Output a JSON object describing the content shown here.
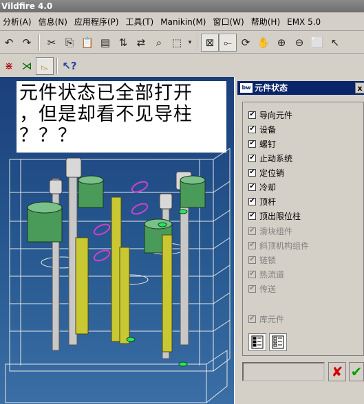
{
  "window": {
    "title": "Vildfire 4.0"
  },
  "menu": [
    "分析(A)",
    "信息(N)",
    "应用程序(P)",
    "工具(T)",
    "Manikin(M)",
    "窗口(W)",
    "帮助(H)",
    "EMX 5.0"
  ],
  "toolbar1_icons": [
    "undo-icon",
    "redo-icon",
    "cut-icon",
    "copy-icon",
    "paste-icon",
    "paste-special-icon",
    "regen-icon",
    "regen-manager-icon",
    "find-icon",
    "select-box-icon",
    "dropdown-icon",
    "repaint-icon",
    "spin-center-icon",
    "orient-mode-icon",
    "pan-icon",
    "zoom-in-icon",
    "zoom-out-icon",
    "refit-icon",
    "cursor-icon"
  ],
  "toolbar2_icons": [
    "datum-axes-icon",
    "datum-points-icon",
    "coord-sys-icon",
    "whats-this-icon"
  ],
  "annotation": {
    "line1": "元件状态已全部打开",
    "line2": "，但是却看不见导柱",
    "line3": "？？？"
  },
  "panel": {
    "title": "元件状态",
    "logo": "bw",
    "close": "x",
    "items": [
      {
        "label": "导向元件",
        "checked": true,
        "enabled": true
      },
      {
        "label": "设备",
        "checked": true,
        "enabled": true
      },
      {
        "label": "螺钉",
        "checked": true,
        "enabled": true
      },
      {
        "label": "止动系统",
        "checked": true,
        "enabled": true
      },
      {
        "label": "定位销",
        "checked": true,
        "enabled": true
      },
      {
        "label": "冷却",
        "checked": true,
        "enabled": true
      },
      {
        "label": "顶杆",
        "checked": true,
        "enabled": true
      },
      {
        "label": "顶出限位柱",
        "checked": true,
        "enabled": true
      },
      {
        "label": "滑块组件",
        "checked": true,
        "enabled": false
      },
      {
        "label": "斜顶机构组件",
        "checked": true,
        "enabled": false
      },
      {
        "label": "链锁",
        "checked": true,
        "enabled": false
      },
      {
        "label": "热流道",
        "checked": true,
        "enabled": false
      },
      {
        "label": "传送",
        "checked": true,
        "enabled": false
      },
      {
        "label": "库元件",
        "checked": true,
        "enabled": false
      }
    ],
    "check_glyph": "✔",
    "ok_glyph": "✔",
    "cancel_glyph": "✘",
    "colors": {
      "cancel": "#d40000",
      "ok": "#00a000"
    }
  }
}
